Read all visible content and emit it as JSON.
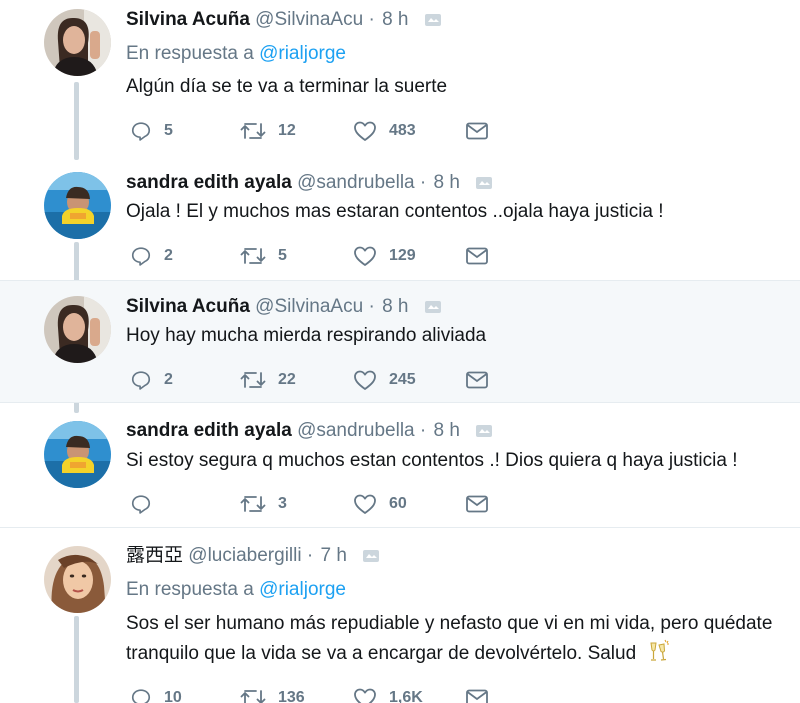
{
  "tweets": [
    {
      "name": "Silvina Acuña",
      "handle": "@SilvinaAcu",
      "dot": "·",
      "time": "8 h",
      "reply_prefix": "En respuesta a",
      "reply_mention": "@rialjorge",
      "text": "Algún día se te va a terminar la suerte",
      "replies": "5",
      "retweets": "12",
      "likes": "483"
    },
    {
      "name": "sandra edith ayala",
      "handle": "@sandrubella",
      "dot": "·",
      "time": "8 h",
      "text": "Ojala ! El y muchos mas estaran contentos ..ojala haya justicia !",
      "replies": "2",
      "retweets": "5",
      "likes": "129"
    },
    {
      "name": "Silvina Acuña",
      "handle": "@SilvinaAcu",
      "dot": "·",
      "time": "8 h",
      "text": "Hoy hay mucha mierda respirando aliviada",
      "replies": "2",
      "retweets": "22",
      "likes": "245"
    },
    {
      "name": "sandra edith ayala",
      "handle": "@sandrubella",
      "dot": "·",
      "time": "8 h",
      "text": "Si estoy segura q muchos estan contentos .! Dios quiera q haya justicia !",
      "replies": "",
      "retweets": "3",
      "likes": "60"
    },
    {
      "name": "露西亞",
      "handle": "@luciabergilli",
      "dot": "·",
      "time": "7 h",
      "reply_prefix": "En respuesta a",
      "reply_mention": "@rialjorge",
      "text_line1": "Sos el ser humano más repudiable y nefasto que vi en mi vida, pero quédate",
      "text_line2": "tranquilo que la vida se va a encargar de devolvértelo. Salud",
      "replies": "10",
      "retweets": "136",
      "likes": "1,6K"
    }
  ],
  "icons": [
    "reply-icon",
    "retweet-icon",
    "like-icon",
    "direct-message-icon",
    "gray-badge-icon",
    "champagne-emoji-icon"
  ],
  "colors": {
    "text": "#14171a",
    "secondary": "#657786",
    "link": "#1da1f2",
    "thread_line": "#ccd6dd",
    "highlight_bg": "#f5f8fa"
  }
}
